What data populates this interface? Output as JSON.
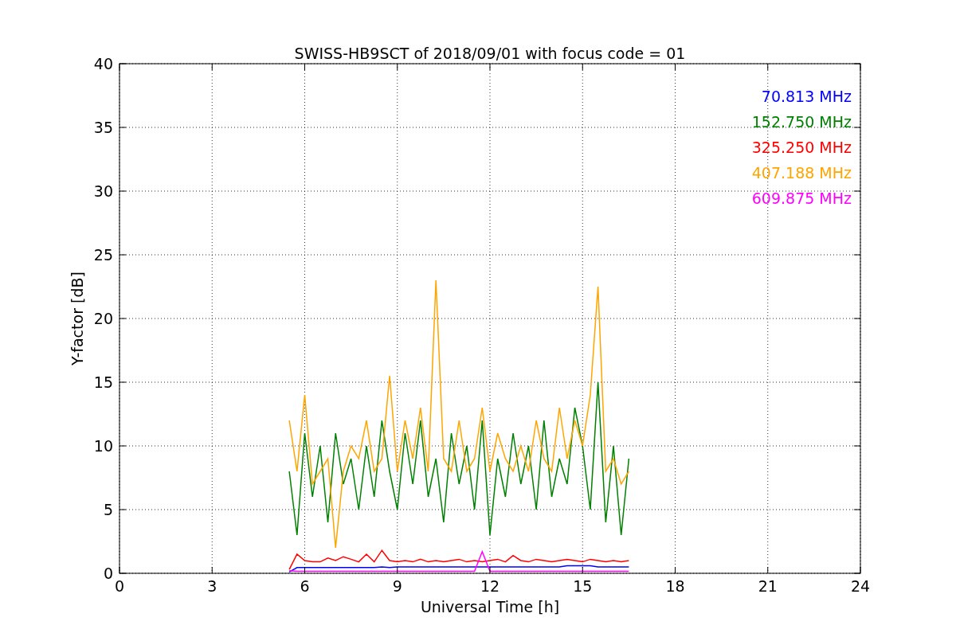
{
  "chart_data": {
    "type": "line",
    "title": "SWISS-HB9SCT of 2018/09/01 with focus code = 01",
    "xlabel": "Universal Time [h]",
    "ylabel": "Y-factor [dB]",
    "xlim": [
      0,
      24
    ],
    "ylim": [
      0,
      40
    ],
    "xticks": [
      0,
      3,
      6,
      9,
      12,
      15,
      18,
      21,
      24
    ],
    "yticks": [
      0,
      5,
      10,
      15,
      20,
      25,
      30,
      35,
      40
    ],
    "grid": true,
    "x": [
      5.5,
      5.75,
      6,
      6.25,
      6.5,
      6.75,
      7,
      7.25,
      7.5,
      7.75,
      8,
      8.25,
      8.5,
      8.75,
      9,
      9.25,
      9.5,
      9.75,
      10,
      10.25,
      10.5,
      10.75,
      11,
      11.25,
      11.5,
      11.75,
      12,
      12.25,
      12.5,
      12.75,
      13,
      13.25,
      13.5,
      13.75,
      14,
      14.25,
      14.5,
      14.75,
      15,
      15.25,
      15.5,
      15.75,
      16,
      16.25,
      16.5
    ],
    "series": [
      {
        "name": "70.813 MHz",
        "color": "#0000ff",
        "values": [
          0.1,
          0.45,
          0.45,
          0.45,
          0.45,
          0.45,
          0.45,
          0.45,
          0.45,
          0.45,
          0.45,
          0.45,
          0.5,
          0.45,
          0.5,
          0.5,
          0.5,
          0.5,
          0.5,
          0.5,
          0.5,
          0.5,
          0.5,
          0.5,
          0.5,
          0.5,
          0.5,
          0.5,
          0.5,
          0.5,
          0.5,
          0.5,
          0.5,
          0.5,
          0.5,
          0.5,
          0.6,
          0.6,
          0.6,
          0.6,
          0.5,
          0.5,
          0.5,
          0.5,
          0.5
        ]
      },
      {
        "name": "152.750 MHz",
        "color": "#008000",
        "values": [
          8,
          3,
          11,
          6,
          10,
          4,
          11,
          7,
          9,
          5,
          10,
          6,
          12,
          8,
          5,
          11,
          7,
          12,
          6,
          9,
          4,
          11,
          7,
          10,
          5,
          12,
          3,
          9,
          6,
          11,
          7,
          10,
          5,
          12,
          6,
          9,
          7,
          13,
          10,
          5,
          15,
          4,
          10,
          3,
          9
        ]
      },
      {
        "name": "325.250 MHz",
        "color": "#ff0000",
        "values": [
          0.3,
          1.5,
          1.0,
          0.9,
          0.9,
          1.2,
          1.0,
          1.3,
          1.1,
          0.9,
          1.5,
          0.9,
          1.8,
          1.0,
          0.9,
          1.0,
          0.9,
          1.1,
          0.9,
          1.0,
          0.9,
          1.0,
          1.1,
          0.9,
          1.0,
          0.9,
          1.0,
          1.1,
          0.9,
          1.4,
          1.0,
          0.9,
          1.1,
          1.0,
          0.9,
          1.0,
          1.1,
          1.0,
          0.9,
          1.1,
          1.0,
          0.9,
          1.0,
          0.9,
          1.0
        ]
      },
      {
        "name": "407.188 MHz",
        "color": "#ffa500",
        "values": [
          12,
          8,
          14,
          7,
          8,
          9,
          2,
          8,
          10,
          9,
          12,
          8,
          9,
          15.5,
          8,
          12,
          9,
          13,
          8,
          23,
          9,
          8,
          12,
          8,
          9,
          13,
          8,
          11,
          9,
          8,
          10,
          8,
          12,
          9,
          8,
          13,
          9,
          12,
          10,
          14,
          22.5,
          8,
          9,
          7,
          8
        ]
      },
      {
        "name": "609.875 MHz",
        "color": "#ff00ff",
        "values": [
          0.2,
          0.15,
          0.15,
          0.15,
          0.15,
          0.15,
          0.15,
          0.15,
          0.15,
          0.15,
          0.15,
          0.15,
          0.15,
          0.15,
          0.15,
          0.15,
          0.15,
          0.15,
          0.15,
          0.15,
          0.15,
          0.15,
          0.15,
          0.15,
          0.15,
          1.7,
          0.15,
          0.15,
          0.15,
          0.15,
          0.15,
          0.15,
          0.15,
          0.15,
          0.15,
          0.15,
          0.15,
          0.15,
          0.15,
          0.15,
          0.15,
          0.15,
          0.15,
          0.15,
          0.15
        ]
      }
    ]
  }
}
